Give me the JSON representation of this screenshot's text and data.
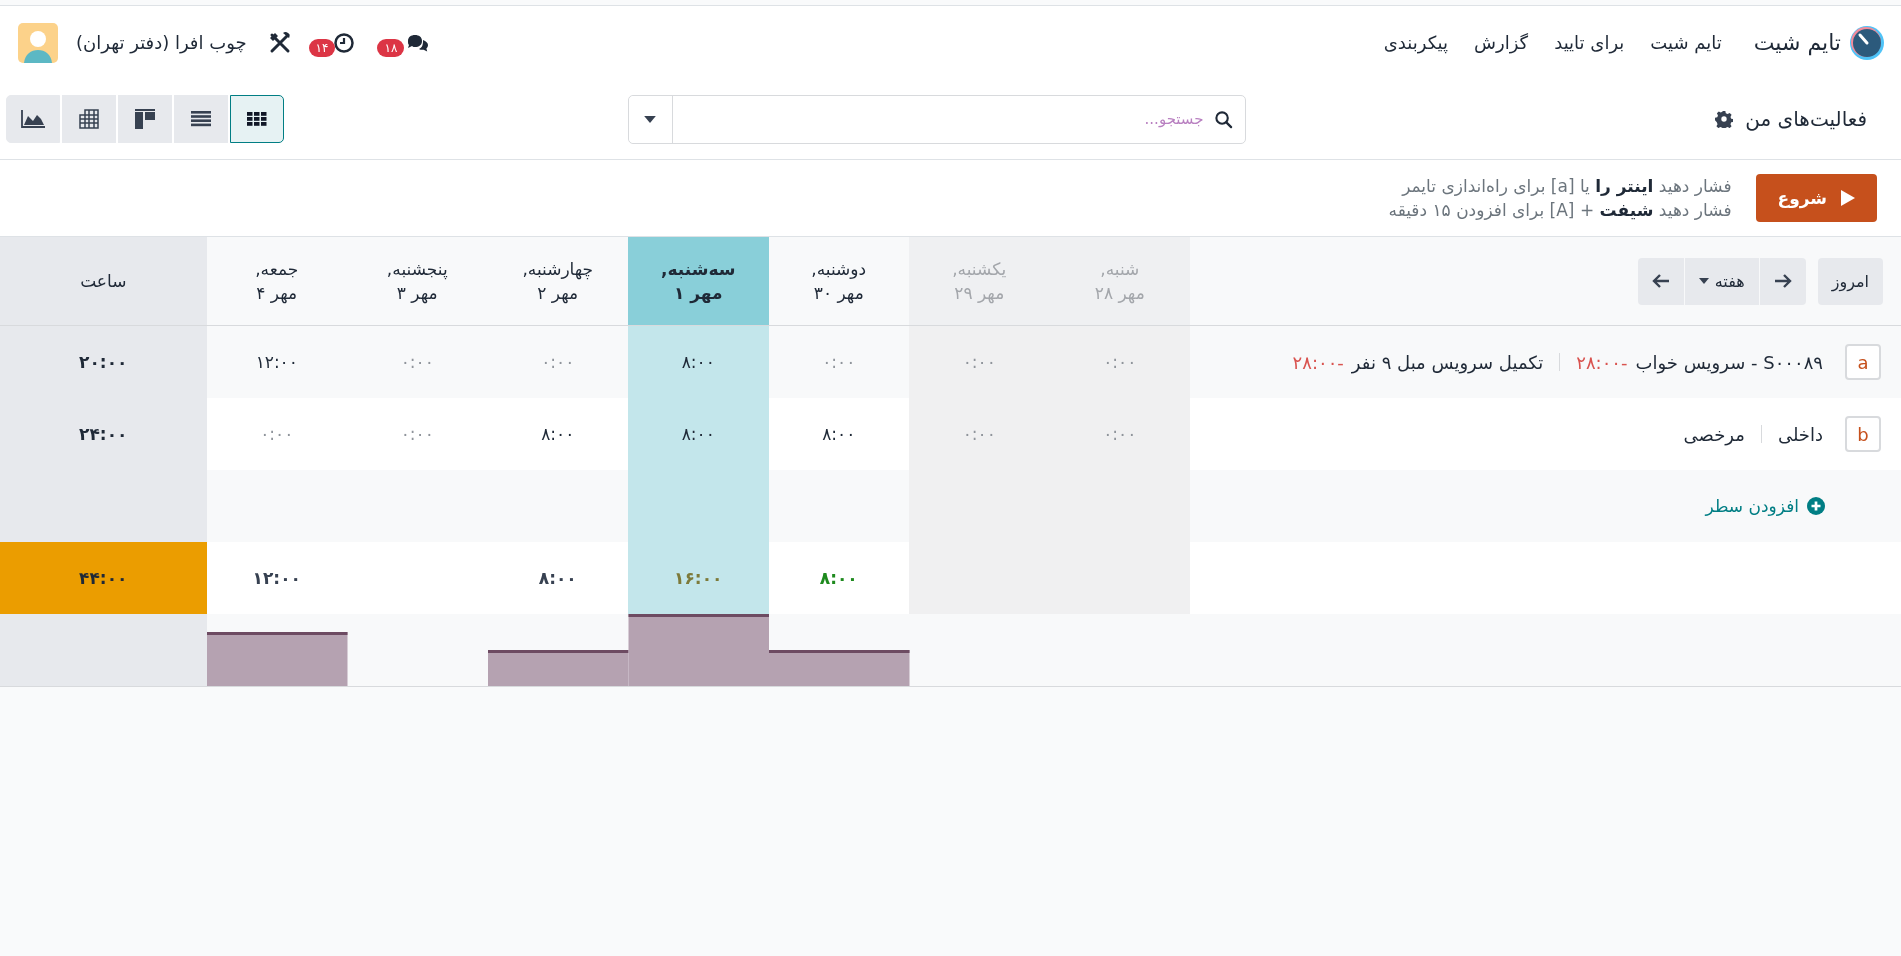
{
  "app": {
    "name": "تایم شیت"
  },
  "menu": [
    "تایم شیت",
    "برای تایید",
    "گزارش",
    "پیکربندی"
  ],
  "systray": {
    "messages_badge": "۱۸",
    "activities_badge": "۱۴",
    "company": "چوب افرا (دفتر تهران)"
  },
  "control_panel": {
    "title": "فعالیت‌های من",
    "search": {
      "placeholder": "جستجو..."
    },
    "views": [
      {
        "kind": "grid",
        "selected": true
      },
      {
        "kind": "list",
        "selected": false
      },
      {
        "kind": "kanban",
        "selected": false
      },
      {
        "kind": "pivot",
        "selected": false
      },
      {
        "kind": "graph",
        "selected": false
      }
    ]
  },
  "timer": {
    "button": "شروع",
    "hints": [
      "فشار دهید **اینتر را** یا [a] برای راه‌اندازی تایمر",
      "فشار دهید **شیفت** + [A] برای افزودن ۱۵ دقیقه"
    ]
  },
  "grid": {
    "today_button": "امروز",
    "range": "هفته",
    "total_label": "ساعت",
    "days": [
      {
        "weekday": "شنبه,",
        "date": "مهر ۲۸",
        "weekend": true,
        "selected": false
      },
      {
        "weekday": "یکشنبه,",
        "date": "مهر ۲۹",
        "weekend": true,
        "selected": false
      },
      {
        "weekday": "دوشنبه,",
        "date": "مهر ۳۰",
        "weekend": false,
        "selected": false,
        "total": {
          "text": "۸:۰۰",
          "color": "#1e8a1e"
        }
      },
      {
        "weekday": "سه‌شنبه,",
        "date": "مهر ۱",
        "weekend": false,
        "selected": true,
        "total": {
          "text": "۱۶:۰۰",
          "color": "#7d7a3a"
        }
      },
      {
        "weekday": "چهارشنبه,",
        "date": "مهر ۲",
        "weekend": false,
        "selected": false,
        "total": {
          "text": "۸:۰۰",
          "color": "#374151"
        }
      },
      {
        "weekday": "پنجشنبه,",
        "date": "مهر ۳",
        "weekend": false,
        "selected": false
      },
      {
        "weekday": "جمعه,",
        "date": "مهر ۴",
        "weekend": false,
        "selected": false,
        "total": {
          "text": "۱۲:۰۰",
          "color": "#374151"
        }
      }
    ],
    "rows": [
      {
        "key": "a",
        "parts": [
          {
            "text": "S۰۰۰۸۹ - سرویس خواب",
            "overtime": "-۲۸:۰۰"
          },
          {
            "text": "تکمیل سرویس مبل ۹ نفر",
            "overtime": "-۲۸:۰۰"
          }
        ],
        "cells": [
          {
            "text": "۰:۰۰",
            "muted": true
          },
          {
            "text": "۰:۰۰",
            "muted": true
          },
          {
            "text": "۰:۰۰",
            "muted": true
          },
          {
            "text": "۸:۰۰",
            "muted": false
          },
          {
            "text": "۰:۰۰",
            "muted": true
          },
          {
            "text": "۰:۰۰",
            "muted": true
          },
          {
            "text": "۱۲:۰۰",
            "muted": false
          }
        ],
        "total": "۲۰:۰۰"
      },
      {
        "key": "b",
        "parts": [
          {
            "text": "داخلی"
          },
          {
            "text": "مرخصی"
          }
        ],
        "cells": [
          {
            "text": "۰:۰۰",
            "muted": true
          },
          {
            "text": "۰:۰۰",
            "muted": true
          },
          {
            "text": "۸:۰۰",
            "muted": false
          },
          {
            "text": "۸:۰۰",
            "muted": false
          },
          {
            "text": "۸:۰۰",
            "muted": false
          },
          {
            "text": "۰:۰۰",
            "muted": true
          },
          {
            "text": "۰:۰۰",
            "muted": true
          }
        ],
        "total": "۲۴:۰۰"
      }
    ],
    "add_line": "افزودن سطر",
    "grand_total": {
      "text": "۴۴:۰۰",
      "warning": true
    }
  }
}
